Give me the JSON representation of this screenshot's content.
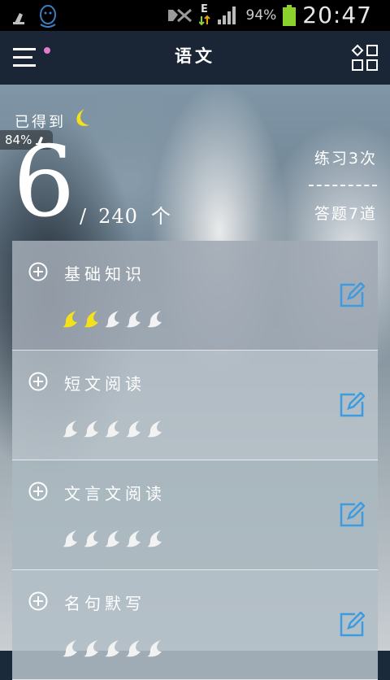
{
  "status_bar": {
    "battery_text": "94%",
    "time": "20:47",
    "network_label": "E",
    "icons": [
      "cleaner-icon",
      "qq-icon",
      "silent-icon",
      "data-arrows-icon",
      "signal-icon",
      "battery-icon"
    ]
  },
  "app_bar": {
    "title": "语文",
    "menu_icon": "menu-icon",
    "grid_icon": "grid-icon",
    "notification_dot_color": "#e37bd1"
  },
  "stats": {
    "earned_label": "已得到",
    "earned_count": "6",
    "slash": "/",
    "total": "240",
    "unit": "个",
    "practice": "练习3次",
    "answered": "答题7道",
    "percent_badge": "84%"
  },
  "sections": [
    {
      "title": "基础知识",
      "moons_earned": 2,
      "moons_total": 5
    },
    {
      "title": "短文阅读",
      "moons_earned": 0,
      "moons_total": 5
    },
    {
      "title": "文言文阅读",
      "moons_earned": 0,
      "moons_total": 5
    },
    {
      "title": "名句默写",
      "moons_earned": 0,
      "moons_total": 5
    }
  ],
  "colors": {
    "accent_blue": "#3d9be0",
    "moon_lit": "#f5e11b",
    "moon_unlit": "#f2f2f2",
    "appbar_bg": "#1a2535"
  }
}
